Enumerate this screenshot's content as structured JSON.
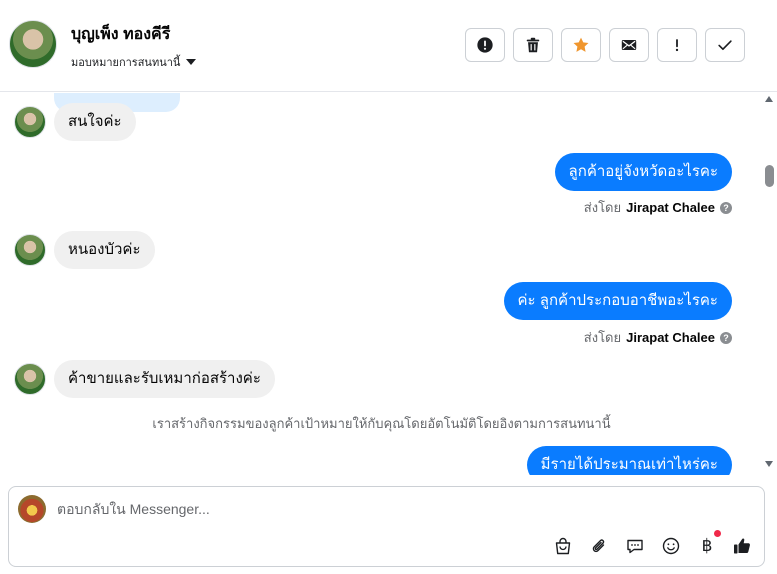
{
  "header": {
    "contact_name": "บุญเพ็ง ทองคีรี",
    "assign_label": "มอบหมายการสนทนานี้",
    "toolbar": [
      {
        "name": "spam-button",
        "icon": "alert-circle-icon"
      },
      {
        "name": "delete-button",
        "icon": "trash-icon"
      },
      {
        "name": "star-button",
        "icon": "star-icon"
      },
      {
        "name": "mark-unread-button",
        "icon": "envelope-icon"
      },
      {
        "name": "follow-up-button",
        "icon": "exclamation-icon"
      },
      {
        "name": "done-button",
        "icon": "checkmark-icon"
      }
    ]
  },
  "messages": [
    {
      "direction": "in",
      "text": "สนใจค่ะ"
    },
    {
      "direction": "out",
      "text": "ลูกค้าอยู่จังหวัดอะไรคะ",
      "sent_by_prefix": "ส่งโดย",
      "sent_by_name": "Jirapat Chalee"
    },
    {
      "direction": "in",
      "text": "หนองบัวค่ะ"
    },
    {
      "direction": "out",
      "text": "ค่ะ ลูกค้าประกอบอาชีพอะไรคะ",
      "sent_by_prefix": "ส่งโดย",
      "sent_by_name": "Jirapat Chalee"
    },
    {
      "direction": "in",
      "text": "ค้าขายและรับเหมาก่อสร้างค่ะ"
    },
    {
      "direction": "system",
      "text": "เราสร้างกิจกรรมของลูกค้าเป้าหมายให้กับคุณโดยอัตโนมัติโดยอิงตามการสนทนานี้"
    },
    {
      "direction": "out",
      "text": "มีรายได้ประมาณเท่าไหร่คะ"
    }
  ],
  "composer": {
    "placeholder": "ตอบกลับใน Messenger...",
    "value": "",
    "icons": [
      "shopping-bag-icon",
      "paperclip-icon",
      "saved-reply-icon",
      "emoji-icon",
      "baht-payment-icon",
      "thumbs-up-icon"
    ],
    "baht_symbol": "฿"
  },
  "colors": {
    "outgoing_bubble": "#0a7cff",
    "incoming_bubble": "#f0f0f0",
    "star": "#f0962e",
    "notification_dot": "#f02849"
  }
}
